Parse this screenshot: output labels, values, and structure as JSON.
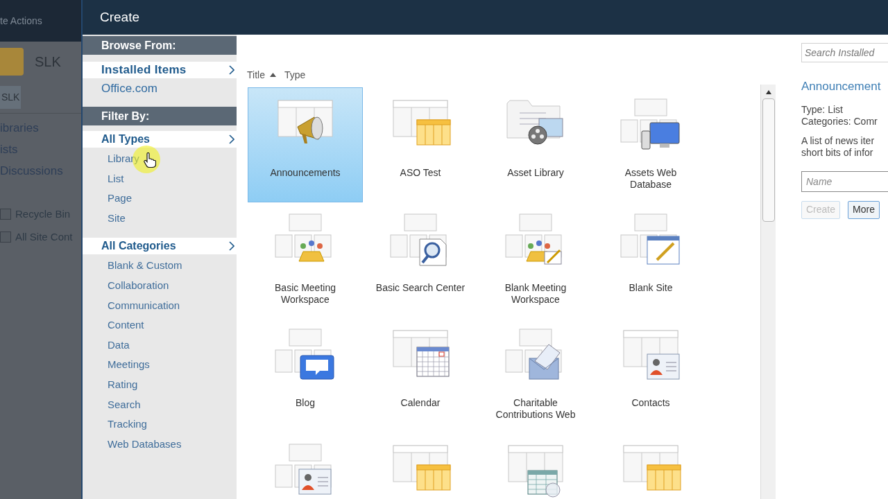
{
  "background_page": {
    "menu": "te Actions",
    "site_title": "SLK",
    "tab": "SLK",
    "nav_items": [
      "ibraries",
      "ists",
      "Discussions"
    ],
    "footer_links": [
      "Recycle Bin",
      "All Site Cont"
    ]
  },
  "dialog": {
    "title": "Create"
  },
  "browse": {
    "header": "Browse From:",
    "items": [
      {
        "label": "Installed Items",
        "selected": true
      },
      {
        "label": "Office.com",
        "selected": false
      }
    ]
  },
  "filter": {
    "header": "Filter By:",
    "groups": [
      {
        "label": "All Types",
        "selected": true,
        "items": [
          "Library",
          "List",
          "Page",
          "Site"
        ]
      },
      {
        "label": "All Categories",
        "selected": true,
        "items": [
          "Blank & Custom",
          "Collaboration",
          "Communication",
          "Content",
          "Data",
          "Meetings",
          "Rating",
          "Search",
          "Tracking",
          "Web Databases"
        ]
      }
    ]
  },
  "sort": [
    {
      "label": "Title",
      "selected": true
    },
    {
      "label": "Type",
      "selected": false
    }
  ],
  "templates": [
    {
      "kind": "megaphone",
      "label": "Announcements",
      "selected": true
    },
    {
      "kind": "spreadsheet",
      "label": "ASO Test",
      "selected": false
    },
    {
      "kind": "media",
      "label": "Asset Library",
      "selected": false
    },
    {
      "kind": "devices",
      "label": "Assets Web Database",
      "selected": false
    },
    {
      "kind": "meeting",
      "label": "Basic Meeting Workspace",
      "selected": false
    },
    {
      "kind": "search",
      "label": "Basic Search Center",
      "selected": false
    },
    {
      "kind": "meetingform",
      "label": "Blank Meeting Workspace",
      "selected": false
    },
    {
      "kind": "blanksite",
      "label": "Blank Site",
      "selected": false
    },
    {
      "kind": "blog",
      "label": "Blog",
      "selected": false
    },
    {
      "kind": "calendar",
      "label": "Calendar",
      "selected": false
    },
    {
      "kind": "envelope",
      "label": "Charitable Contributions Web",
      "selected": false
    },
    {
      "kind": "contact",
      "label": "Contacts",
      "selected": false
    },
    {
      "kind": "contactsite",
      "selected": false
    },
    {
      "kind": "spreadsheet",
      "selected": false
    },
    {
      "kind": "datasheet",
      "selected": false
    },
    {
      "kind": "spreadsheet",
      "selected": false
    }
  ],
  "details": {
    "search_placeholder": "Search Installed",
    "title": "Announcement",
    "type": "Type: List",
    "categories": "Categories: Comr",
    "description_lines": [
      "A list of news iter",
      "short bits of infor"
    ],
    "name_placeholder": "Name",
    "buttons": [
      {
        "label": "Create",
        "disabled": true
      },
      {
        "label": "More",
        "disabled": false
      }
    ]
  }
}
